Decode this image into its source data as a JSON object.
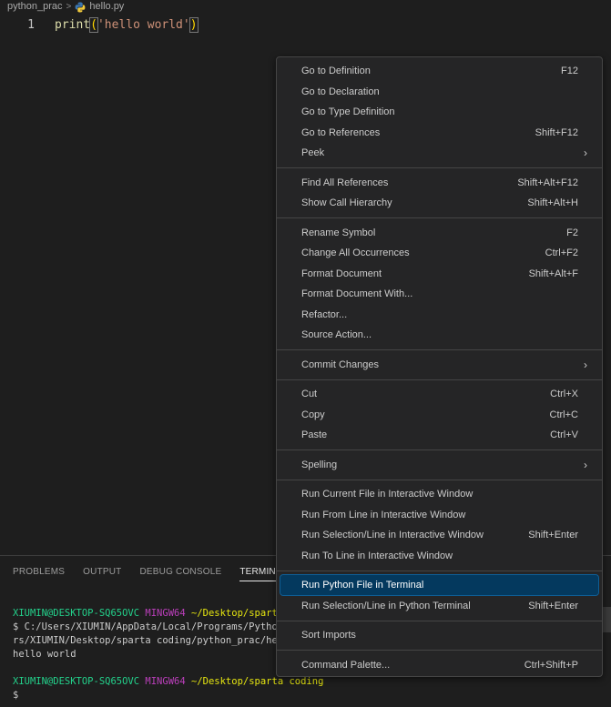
{
  "breadcrumb": {
    "folder": "python_prac",
    "file": "hello.py"
  },
  "editor": {
    "line_number": "1",
    "code_fn": "print",
    "code_open": "(",
    "code_str": "'hello world'",
    "code_close": ")"
  },
  "panel": {
    "tabs": [
      "PROBLEMS",
      "OUTPUT",
      "DEBUG CONSOLE",
      "TERMINAL"
    ],
    "active_tab": "TERMINAL",
    "terminal": {
      "line1_user": "XIUMIN@DESKTOP-SQ65OVC",
      "line1_env": "MINGW64",
      "line1_path": "~/Desktop/sparta",
      "line2": "$ C:/Users/XIUMIN/AppData/Local/Programs/Python/",
      "line3": "rs/XIUMIN/Desktop/sparta coding/python_prac/hell",
      "line4": "hello world",
      "line6_user": "XIUMIN@DESKTOP-SQ65OVC",
      "line6_env": "MINGW64",
      "line6_path": "~/Desktop/sparta coding",
      "line7": "$"
    }
  },
  "menu": {
    "groups": [
      [
        {
          "label": "Go to Definition",
          "key": "F12"
        },
        {
          "label": "Go to Declaration",
          "key": ""
        },
        {
          "label": "Go to Type Definition",
          "key": ""
        },
        {
          "label": "Go to References",
          "key": "Shift+F12"
        },
        {
          "label": "Peek",
          "key": "",
          "submenu": true
        }
      ],
      [
        {
          "label": "Find All References",
          "key": "Shift+Alt+F12"
        },
        {
          "label": "Show Call Hierarchy",
          "key": "Shift+Alt+H"
        }
      ],
      [
        {
          "label": "Rename Symbol",
          "key": "F2"
        },
        {
          "label": "Change All Occurrences",
          "key": "Ctrl+F2"
        },
        {
          "label": "Format Document",
          "key": "Shift+Alt+F"
        },
        {
          "label": "Format Document With...",
          "key": ""
        },
        {
          "label": "Refactor...",
          "key": ""
        },
        {
          "label": "Source Action...",
          "key": ""
        }
      ],
      [
        {
          "label": "Commit Changes",
          "key": "",
          "submenu": true
        }
      ],
      [
        {
          "label": "Cut",
          "key": "Ctrl+X"
        },
        {
          "label": "Copy",
          "key": "Ctrl+C"
        },
        {
          "label": "Paste",
          "key": "Ctrl+V"
        }
      ],
      [
        {
          "label": "Spelling",
          "key": "",
          "submenu": true
        }
      ],
      [
        {
          "label": "Run Current File in Interactive Window",
          "key": ""
        },
        {
          "label": "Run From Line in Interactive Window",
          "key": ""
        },
        {
          "label": "Run Selection/Line in Interactive Window",
          "key": "Shift+Enter"
        },
        {
          "label": "Run To Line in Interactive Window",
          "key": ""
        }
      ],
      [
        {
          "label": "Run Python File in Terminal",
          "key": "",
          "selected": true
        },
        {
          "label": "Run Selection/Line in Python Terminal",
          "key": "Shift+Enter"
        }
      ],
      [
        {
          "label": "Sort Imports",
          "key": ""
        }
      ],
      [
        {
          "label": "Command Palette...",
          "key": "Ctrl+Shift+P"
        }
      ]
    ]
  }
}
